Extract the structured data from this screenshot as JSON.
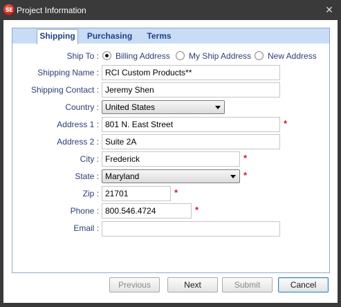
{
  "window": {
    "title": "Project Information",
    "app_icon_text": "SE",
    "close_glyph": "✕"
  },
  "tabs": [
    {
      "label": "Shipping",
      "active": true
    },
    {
      "label": "Purchasing",
      "active": false
    },
    {
      "label": "Terms",
      "active": false
    }
  ],
  "form": {
    "ship_to": {
      "label": "Ship To :",
      "options": [
        "Billing Address",
        "My Ship Address",
        "New Address"
      ],
      "selected": "Billing Address"
    },
    "shipping_name": {
      "label": "Shipping Name :",
      "value": "RCI Custom Products**"
    },
    "shipping_contact": {
      "label": "Shipping Contact :",
      "value": "Jeremy Shen"
    },
    "country": {
      "label": "Country :",
      "value": "United States"
    },
    "address1": {
      "label": "Address 1 :",
      "value": "801 N. East Street",
      "required": "*"
    },
    "address2": {
      "label": "Address 2 :",
      "value": "Suite 2A"
    },
    "city": {
      "label": "City :",
      "value": "Frederick",
      "required": "*"
    },
    "state": {
      "label": "State :",
      "value": "Maryland",
      "required": "*"
    },
    "zip": {
      "label": "Zip :",
      "value": "21701",
      "required": "*"
    },
    "phone": {
      "label": "Phone :",
      "value": "800.546.4724",
      "required": "*"
    },
    "email": {
      "label": "Email :",
      "value": ""
    }
  },
  "buttons": {
    "previous": "Previous",
    "next": "Next",
    "submit": "Submit",
    "cancel": "Cancel"
  },
  "colors": {
    "label_text": "#2a3d7a",
    "tab_text": "#1f3f8a",
    "tab_strip": "#c8ddf5",
    "required": "#e0141e",
    "title_bar": "#3a3a3a"
  }
}
